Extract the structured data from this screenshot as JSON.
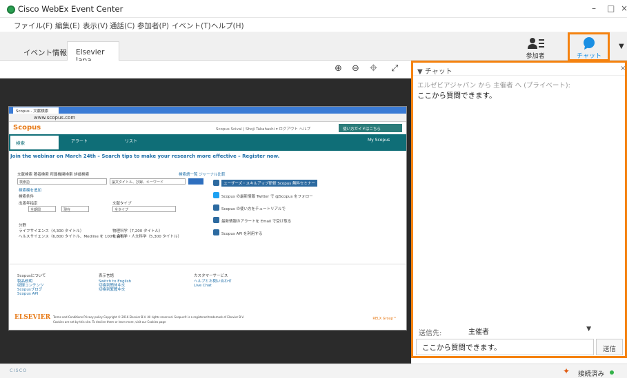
{
  "window": {
    "title": "Cisco WebEx Event Center",
    "minimize": "–",
    "maximize": "□",
    "close": "×"
  },
  "menu": [
    "ファイル(F)",
    "編集(E)",
    "表示(V)",
    "通話(C)",
    "参加者(P)",
    "イベント(T)",
    "ヘルプ(H)"
  ],
  "tabs": [
    {
      "label": "イベント情報"
    },
    {
      "label": "Elsevier Japa..."
    }
  ],
  "toolbar": {
    "participants_label": "参加者",
    "chat_label": "チャット",
    "dropdown_glyph": "▼"
  },
  "viewer": {
    "zoom_in": "⊕",
    "zoom_out": "⊖",
    "fit": "✥",
    "fullscreen": "⤢"
  },
  "shared_page": {
    "tab_title": "Scopus - 文献検索",
    "url": "www.scopus.com",
    "logo": "Scopus",
    "header_links": "Scopus  Scival  |  Shoji Takahashi ▾  ログアウト  ヘルプ",
    "help_button": "使い方ガイドはこちら",
    "nav": [
      "検索",
      "アラート",
      "リスト",
      "My Scopus"
    ],
    "banner": "Join the webinar on March 24th – Search tips to make your research more effective – Register now.",
    "search_tabs": "文献検索  著者検索  所属機関検索  詳細検索",
    "search_tips": "検索語一覧  ジャーナル比較",
    "search_placeholder": "検索語",
    "search_field": "論文タイトル、抄録、キーワード",
    "add_field": "検索欄を追加",
    "limit_label": "検索条件",
    "date_range_label": "出版年指定",
    "date_from": "全期間",
    "date_to": "現在",
    "doc_type_label": "文献タイプ",
    "doc_type": "全タイプ",
    "subject_label": "分野",
    "subject_1": "ライフサイエンス（4,300 タイトル）",
    "subject_2": "ヘルスサイエンス（6,800 タイトル、Medline を 100% 含む）",
    "subject_3": "物理科学（7,200 タイトル）",
    "subject_4": "社会科学・人文科学（5,300 タイトル）",
    "side_1": "ユーザーズ・スキルアップ研修 Scopus 無料セミナー",
    "side_2": "Scopus の最新情報 Twitter で @Scopus をフォロー",
    "side_3": "Scopus の使い方をチュートリアルで",
    "side_4": "最新情報のアラートを Email で受け取る",
    "side_5": "Scopus API を利用する",
    "footer_col1_head": "Scopusについて",
    "footer_col1": "製品説明\n収録コンテンツ\nScopusブログ\nScopus API",
    "footer_col2_head": "表示言語",
    "footer_col2": "Switch to English\n切換到簡体中文\n切換到繁體中文",
    "footer_col3_head": "カスタマーサービス",
    "footer_col3": "ヘルプとお問い合わせ\nLive Chat",
    "elsevier": "ELSEVIER",
    "copyright": "Terms and Conditions   Privacy policy  Copyright © 2016 Elsevier B.V. All rights reserved. Scopus® is a registered trademark of Elsevier B.V.",
    "cookies": "Cookies are set by this site. To decline them or learn more, visit our Cookies page",
    "relx": "RELX Group™"
  },
  "chat": {
    "title": "▼ チャット",
    "close": "×",
    "system_line": "エルゼビアジャパン から 主催者 へ (プライベート):",
    "message": "ここから質問できます。",
    "to_label": "送信先:",
    "to_value": "主催者",
    "input_value": "ここから質問できます。",
    "send_label": "送信"
  },
  "status": {
    "brand": "CISCO",
    "connection": "接続済み",
    "connection_color": "#33b249"
  },
  "highlight_color": "#f5820f"
}
